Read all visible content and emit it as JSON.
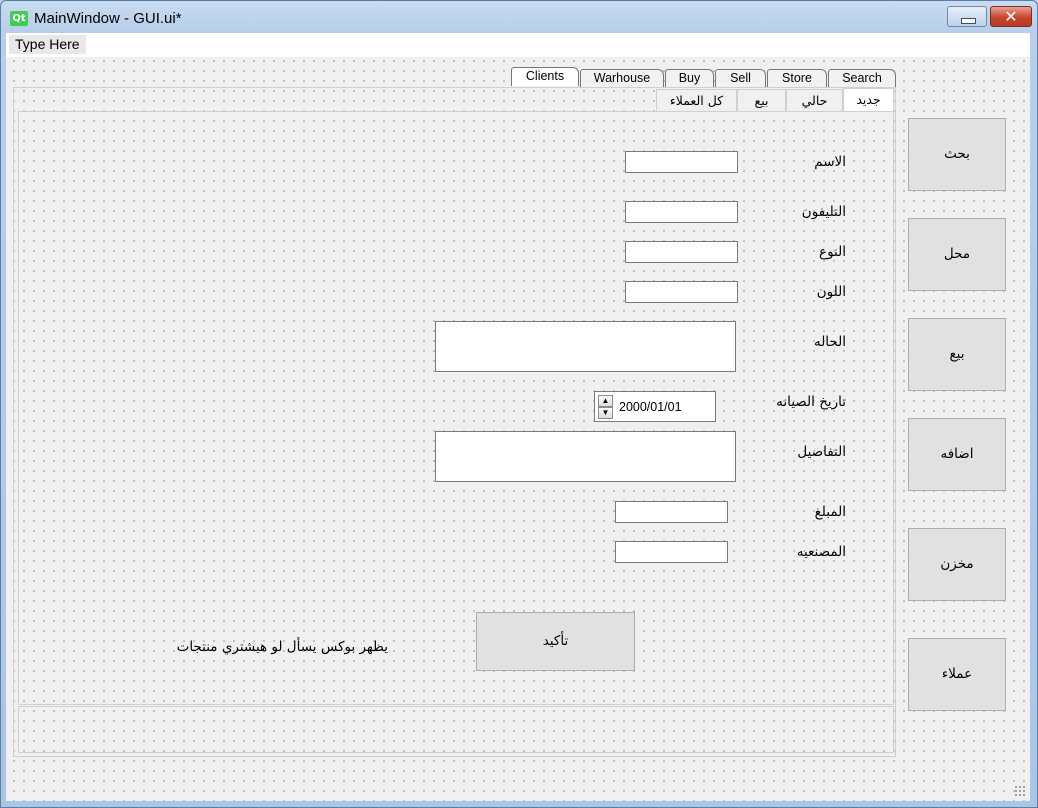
{
  "window": {
    "title": "MainWindow - GUI.ui*",
    "logo": "Qt",
    "close_glyph": "✕"
  },
  "menubar": {
    "type_here": "Type Here"
  },
  "top_tabs": [
    {
      "label": "Clients",
      "active": true
    },
    {
      "label": "Warhouse",
      "active": false
    },
    {
      "label": "Buy",
      "active": false
    },
    {
      "label": "Sell",
      "active": false
    },
    {
      "label": "Store",
      "active": false
    },
    {
      "label": "Search",
      "active": false
    }
  ],
  "inner_tabs": [
    {
      "label": "جديد",
      "active": true
    },
    {
      "label": "حالي",
      "active": false
    },
    {
      "label": "بيع",
      "active": false
    },
    {
      "label": "كل العملاء",
      "active": false
    }
  ],
  "form": {
    "name_label": "الاسم",
    "phone_label": "التليفون",
    "type_label": "النوع",
    "color_label": "اللون",
    "condition_label": "الحاله",
    "maintenance_date_label": "تاريخ الصيانه",
    "maintenance_date_value": "2000/01/01",
    "details_label": "التفاصيل",
    "amount_label": "المبلغ",
    "manufacture_label": "المصنعيه",
    "confirm_button": "تأكيد",
    "hint_text": "يظهر بوكس يسأل لو هيشتري منتجات"
  },
  "side_buttons": {
    "search": "بحث",
    "shop": "محل",
    "sell": "بيع",
    "add": "اضافه",
    "store": "مخزن",
    "clients": "عملاء"
  },
  "colors": {
    "qt_green": "#41cd52",
    "close_red": "#c8442f",
    "window_bg": "#f0f0f0"
  }
}
